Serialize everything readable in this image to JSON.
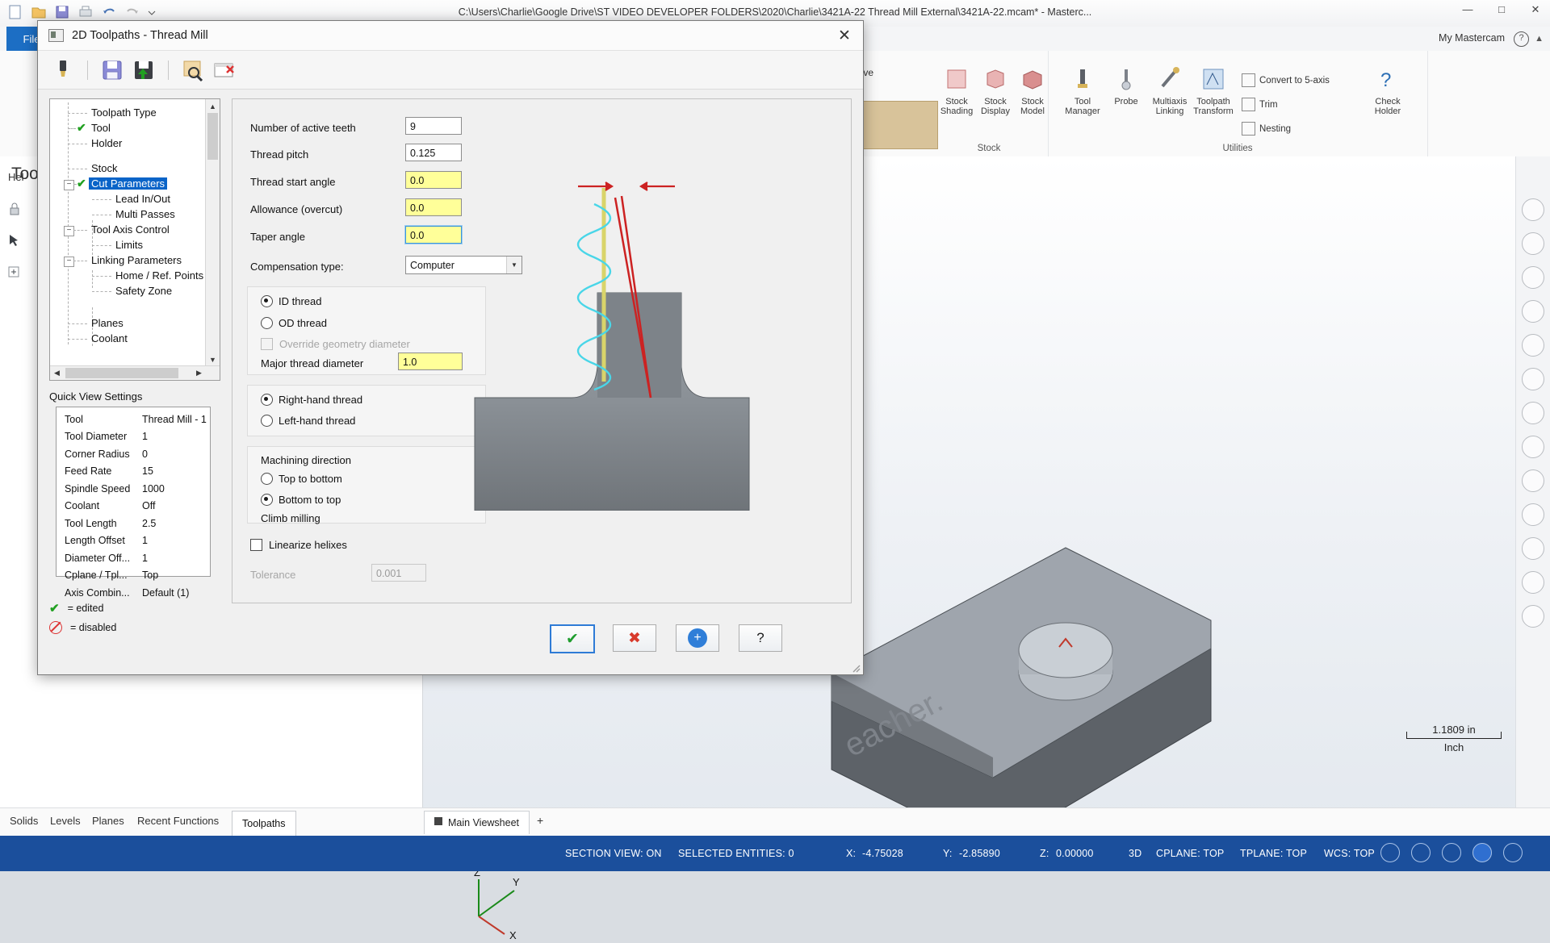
{
  "app": {
    "title": "C:\\Users\\Charlie\\Google Drive\\ST VIDEO DEVELOPER FOLDERS\\2020\\Charlie\\3421A-22 Thread Mill External\\3421A-22.mcam* - Masterc...",
    "file_tab": "File",
    "my_mastercam": "My Mastercam",
    "left_pane_title": "Tool",
    "help_label": "Hel",
    "ribbon": {
      "curve_label": "g Curve",
      "stock_group": "Stock",
      "utilities_group": "Utilities",
      "buttons": [
        {
          "label1": "Stock",
          "label2": "Shading",
          "icon": "stock-shading-icon"
        },
        {
          "label1": "Stock",
          "label2": "Display",
          "icon": "stock-display-icon"
        },
        {
          "label1": "Stock",
          "label2": "Model",
          "icon": "stock-model-icon"
        },
        {
          "label1": "Tool",
          "label2": "Manager",
          "icon": "tool-manager-icon"
        },
        {
          "label1": "Probe",
          "label2": "",
          "icon": "probe-icon"
        },
        {
          "label1": "Multiaxis",
          "label2": "Linking",
          "icon": "multiaxis-linking-icon"
        },
        {
          "label1": "Toolpath",
          "label2": "Transform",
          "icon": "toolpath-transform-icon"
        },
        {
          "label1": "Check",
          "label2": "Holder",
          "icon": "check-holder-icon"
        }
      ],
      "small_buttons": [
        {
          "label": "Convert to 5-axis",
          "icon": "convert-5axis-icon"
        },
        {
          "label": "Trim",
          "icon": "trim-icon"
        },
        {
          "label": "Nesting",
          "icon": "nesting-icon"
        }
      ]
    },
    "bottom_tabs": [
      "Solids",
      "Levels",
      "Planes",
      "Recent Functions",
      "Toolpaths"
    ],
    "active_bottom_tab": "Toolpaths",
    "viewsheet_tab": "Main Viewsheet",
    "viewsheet_add": "+",
    "scale": {
      "value": "1.1809 in",
      "unit": "Inch"
    },
    "axes": {
      "x": "X",
      "y": "Y",
      "z": "Z"
    },
    "status": {
      "section_view": "SECTION VIEW: ON",
      "selected_entities": "SELECTED ENTITIES: 0",
      "x_label": "X:",
      "x_value": "-4.75028",
      "y_label": "Y:",
      "y_value": "-2.85890",
      "z_label": "Z:",
      "z_value": "0.00000",
      "mode": "3D",
      "cplane": "CPLANE: TOP",
      "tplane": "TPLANE: TOP",
      "wcs": "WCS: TOP"
    }
  },
  "dialog": {
    "title": "2D Toolpaths - Thread Mill",
    "close_label": "✕",
    "toolbar": [
      {
        "name": "tool-settings-icon"
      },
      {
        "name": "save-icon"
      },
      {
        "name": "save-as-defaults-icon"
      },
      {
        "name": "preview-icon"
      },
      {
        "name": "clear-icon"
      }
    ],
    "tree": {
      "items": [
        {
          "label": "Toolpath Type",
          "indent": 0,
          "state": "none",
          "expander": false
        },
        {
          "label": "Tool",
          "indent": 0,
          "state": "edited",
          "expander": false
        },
        {
          "label": "Holder",
          "indent": 0,
          "state": "none",
          "expander": false
        },
        {
          "label": "Stock",
          "indent": 0,
          "state": "none",
          "expander": false
        },
        {
          "label": "Cut Parameters",
          "indent": 0,
          "state": "edited",
          "expander": true,
          "selected": true
        },
        {
          "label": "Lead In/Out",
          "indent": 1,
          "state": "none",
          "expander": false
        },
        {
          "label": "Multi Passes",
          "indent": 1,
          "state": "none",
          "expander": false
        },
        {
          "label": "Tool Axis Control",
          "indent": 0,
          "state": "none",
          "expander": true
        },
        {
          "label": "Limits",
          "indent": 1,
          "state": "none",
          "expander": false
        },
        {
          "label": "Linking Parameters",
          "indent": 0,
          "state": "none",
          "expander": true
        },
        {
          "label": "Home / Ref. Points",
          "indent": 1,
          "state": "none",
          "expander": false
        },
        {
          "label": "Safety Zone",
          "indent": 1,
          "state": "none",
          "expander": false
        },
        {
          "label": "Planes",
          "indent": 0,
          "state": "none",
          "expander": false
        },
        {
          "label": "Coolant",
          "indent": 0,
          "state": "none",
          "expander": false
        }
      ]
    },
    "quick_view": {
      "title": "Quick View Settings",
      "rows": [
        {
          "key": "Tool",
          "value": "Thread Mill - 1"
        },
        {
          "key": "Tool Diameter",
          "value": "1"
        },
        {
          "key": "Corner Radius",
          "value": "0"
        },
        {
          "key": "Feed Rate",
          "value": "15"
        },
        {
          "key": "Spindle Speed",
          "value": "1000"
        },
        {
          "key": "Coolant",
          "value": "Off"
        },
        {
          "key": "Tool Length",
          "value": "2.5"
        },
        {
          "key": "Length Offset",
          "value": "1"
        },
        {
          "key": "Diameter Off...",
          "value": "1"
        },
        {
          "key": "Cplane / Tpl...",
          "value": "Top"
        },
        {
          "key": "Axis Combin...",
          "value": "Default (1)"
        }
      ]
    },
    "legend": [
      {
        "icon": "check-icon",
        "text": "= edited"
      },
      {
        "icon": "disabled-icon",
        "text": "= disabled"
      }
    ],
    "fields": {
      "active_teeth": {
        "label": "Number of active teeth",
        "value": "9"
      },
      "thread_pitch": {
        "label": "Thread pitch",
        "value": "0.125"
      },
      "thread_start_angle": {
        "label": "Thread start angle",
        "value": "0.0"
      },
      "allowance": {
        "label": "Allowance (overcut)",
        "value": "0.0"
      },
      "taper_angle": {
        "label": "Taper angle",
        "value": "0.0"
      },
      "compensation": {
        "label": "Compensation type:",
        "value": "Computer"
      },
      "major_thread_diameter": {
        "label": "Major thread diameter",
        "value": "1.0"
      },
      "tolerance": {
        "label": "Tolerance",
        "value": "0.001"
      }
    },
    "thread_side": {
      "id_thread": "ID thread",
      "od_thread": "OD thread",
      "selected": "ID thread",
      "override_geometry": "Override geometry diameter",
      "override_checked": false
    },
    "hand": {
      "right": "Right-hand thread",
      "left": "Left-hand thread",
      "selected": "Right-hand thread"
    },
    "machining_direction": {
      "title": "Machining direction",
      "top_to_bottom": "Top to bottom",
      "bottom_to_top": "Bottom to top",
      "selected": "Bottom to top",
      "milling_note": "Climb milling"
    },
    "linearize": {
      "label": "Linearize helixes",
      "checked": false
    },
    "buttons": [
      {
        "name": "ok-button",
        "glyph": "✔",
        "color": "#1f9d2e"
      },
      {
        "name": "cancel-button",
        "glyph": "✖",
        "color": "#d83a2c"
      },
      {
        "name": "apply-button",
        "glyph": "+",
        "color": "#2f7ed8"
      },
      {
        "name": "help-button",
        "glyph": "?",
        "color": "#1b1b1b"
      }
    ]
  },
  "colors": {
    "accent": "#1b4f9c",
    "highlight": "#0a64c8",
    "yellow_field": "#ffff99",
    "ok_green": "#1f9d2e",
    "cancel_red": "#d83a2c"
  }
}
